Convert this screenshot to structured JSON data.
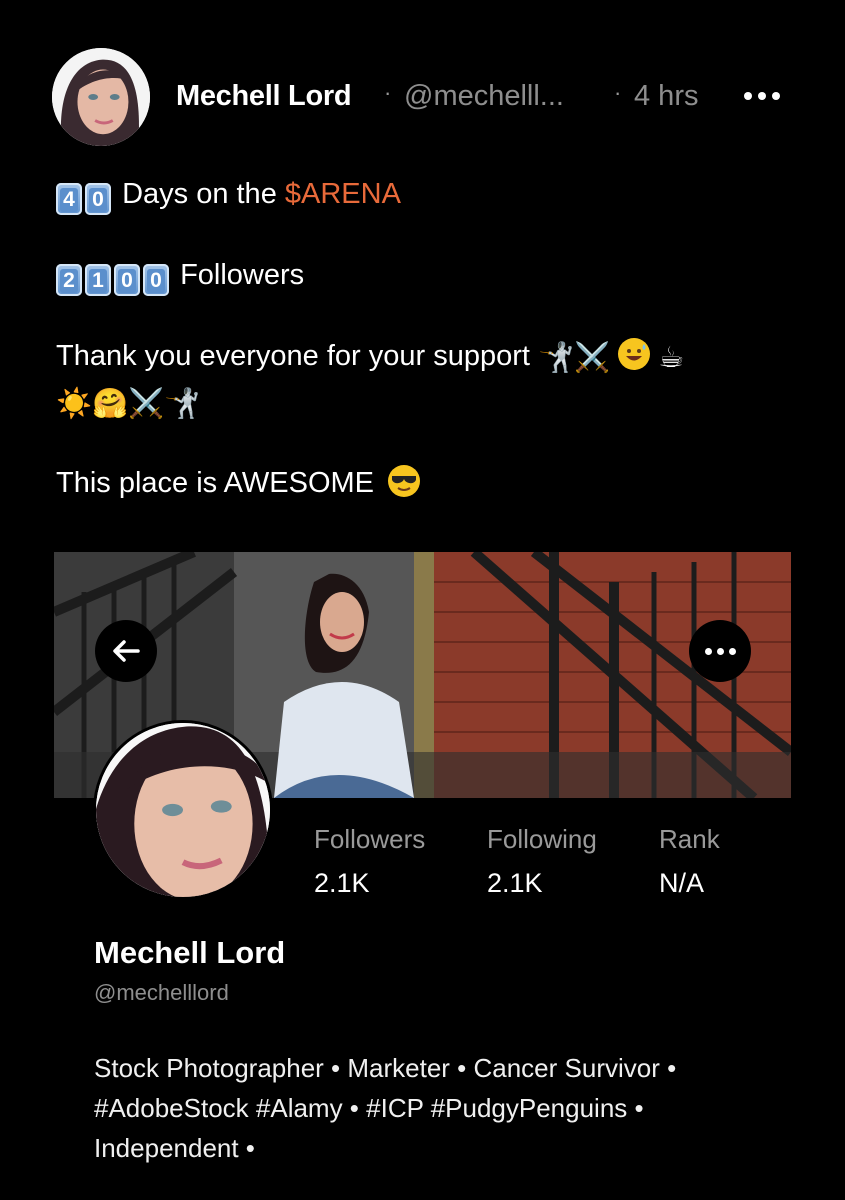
{
  "post": {
    "author_name": "Mechell Lord",
    "separator": "·",
    "handle": "@mechelll...",
    "time": "4 hrs",
    "line1": {
      "digits": [
        "4",
        "0"
      ],
      "text": "Days on the ",
      "ticker": "$ARENA"
    },
    "line2": {
      "digits": [
        "2",
        "1",
        "0",
        "0"
      ],
      "text": "Followers"
    },
    "line3": {
      "text": "Thank you everyone for your support",
      "emojis_a": "🤺⚔️",
      "emojis_b": "☕"
    },
    "line4": {
      "emojis": "☀️🤗⚔️🤺"
    },
    "line5": {
      "text": "This place is AWESOME"
    }
  },
  "profile": {
    "stats": [
      {
        "label": "Followers",
        "value": "2.1K"
      },
      {
        "label": "Following",
        "value": "2.1K"
      },
      {
        "label": "Rank",
        "value": "N/A"
      }
    ],
    "name": "Mechell Lord",
    "handle": "@mechelllord",
    "bio": "Stock Photographer • Marketer • Cancer Survivor • #AdobeStock #Alamy • #ICP #PudgyPenguins • Independent •"
  },
  "colors": {
    "ticker": "#e86a3a",
    "background": "#000000",
    "muted": "#8e8e8e"
  }
}
